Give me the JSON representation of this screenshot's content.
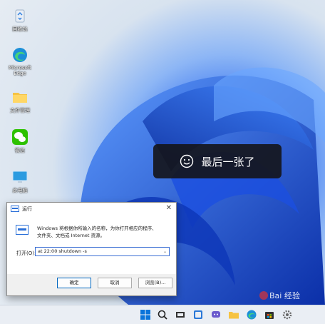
{
  "desktop": {
    "icons": [
      {
        "label": "回收站",
        "icon": "recycle-bin-icon"
      },
      {
        "label": "Microsoft Edge",
        "icon": "edge-icon"
      },
      {
        "label": "文件管理",
        "icon": "folder-icon"
      },
      {
        "label": "微信",
        "icon": "wechat-icon"
      },
      {
        "label": "此电脑",
        "icon": "monitor-icon"
      }
    ]
  },
  "toast": {
    "text": "最后一张了",
    "icon": "smile-icon"
  },
  "run_dialog": {
    "title": "运行",
    "description_line1": "Windows 将根据你所输入的名称，为你打开相应的程序、",
    "description_line2": "文件夹、文档或 Internet 资源。",
    "open_label": "打开(O):",
    "command_value": "at 22:00 shutdown -s",
    "ok_label": "确定",
    "cancel_label": "取消",
    "browse_label": "浏览(B)..."
  },
  "taskbar": {
    "items": [
      "windows-start-icon",
      "search-icon",
      "task-view-icon",
      "widgets-icon",
      "chat-icon",
      "file-explorer-icon",
      "edge-icon",
      "store-icon",
      "settings-icon"
    ]
  },
  "watermark": {
    "text": "Bai 经验"
  }
}
